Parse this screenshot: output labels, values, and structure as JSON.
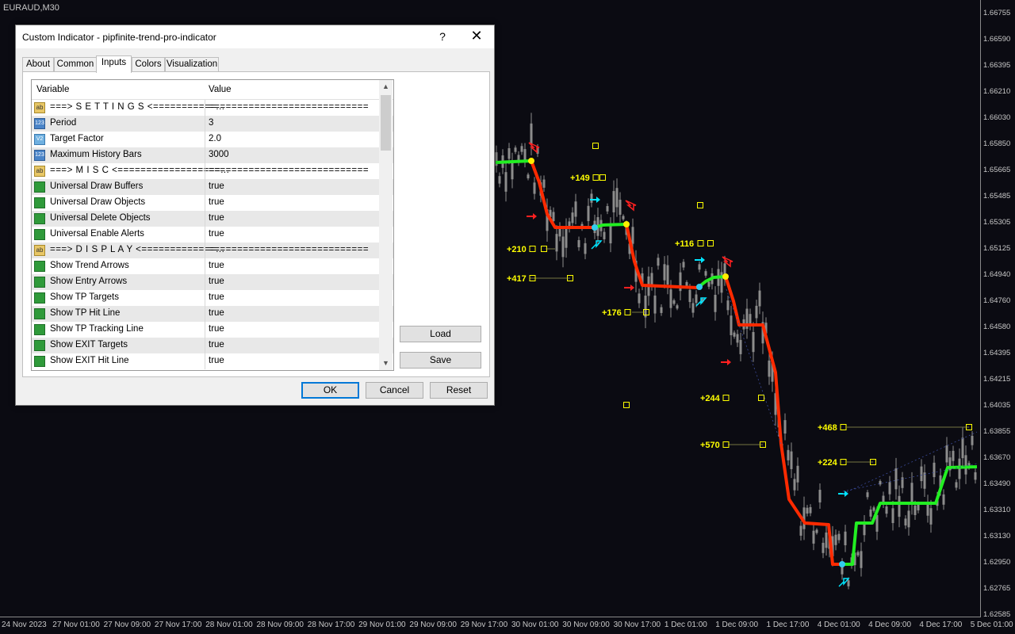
{
  "chart": {
    "symbol": "EURAUD,M30",
    "price_ticks": [
      "1.66755",
      "1.66590",
      "1.66395",
      "1.66210",
      "1.66030",
      "1.65850",
      "1.65665",
      "1.65485",
      "1.65305",
      "1.65125",
      "1.64940",
      "1.64760",
      "1.64580",
      "1.64395",
      "1.64215",
      "1.64035",
      "1.63855",
      "1.63670",
      "1.63490",
      "1.63310",
      "1.63130",
      "1.62950",
      "1.62765",
      "1.62585"
    ],
    "time_ticks": [
      "24 Nov 2023",
      "27 Nov 01:00",
      "27 Nov 09:00",
      "27 Nov 17:00",
      "28 Nov 01:00",
      "28 Nov 09:00",
      "28 Nov 17:00",
      "29 Nov 01:00",
      "29 Nov 09:00",
      "29 Nov 17:00",
      "30 Nov 01:00",
      "30 Nov 09:00",
      "30 Nov 17:00",
      "1 Dec 01:00",
      "1 Dec 09:00",
      "1 Dec 17:00",
      "4 Dec 01:00",
      "4 Dec 09:00",
      "4 Dec 17:00",
      "5 Dec 01:00"
    ],
    "tp_labels": [
      "+149",
      "+210",
      "+417",
      "+116",
      "+176",
      "+244",
      "+570",
      "+468",
      "+224"
    ],
    "colors": {
      "uptrend": "#22ee22",
      "downtrend": "#ff2a00",
      "up_arrow": "#00e5ff",
      "down_arrow": "#ff2020",
      "tp": "#ffff00",
      "candle": "#8c8c8c"
    }
  },
  "dialog": {
    "title": "Custom Indicator - pipfinite-trend-pro-indicator",
    "help": "?",
    "close": "✕",
    "tabs": [
      "About",
      "Common",
      "Inputs",
      "Colors",
      "Visualization"
    ],
    "active_tab": "Inputs",
    "columns": {
      "variable": "Variable",
      "value": "Value"
    },
    "rows": [
      {
        "icon": "ab",
        "name": "===> S E T T I N G S <===========...",
        "value": "============================"
      },
      {
        "icon": "123",
        "name": "Period",
        "value": "3"
      },
      {
        "icon": "v2",
        "name": "Target Factor",
        "value": "2.0"
      },
      {
        "icon": "123",
        "name": "Maximum History Bars",
        "value": "3000"
      },
      {
        "icon": "ab",
        "name": "===> M I S C <==================...",
        "value": "============================"
      },
      {
        "icon": "bool",
        "name": "Universal Draw Buffers",
        "value": "true"
      },
      {
        "icon": "bool",
        "name": "Universal Draw Objects",
        "value": "true"
      },
      {
        "icon": "bool",
        "name": "Universal Delete Objects",
        "value": "true"
      },
      {
        "icon": "bool",
        "name": "Universal Enable Alerts",
        "value": "true"
      },
      {
        "icon": "ab",
        "name": "===> D I S P L A Y <=============...",
        "value": "============================"
      },
      {
        "icon": "bool",
        "name": "Show Trend Arrows",
        "value": "true"
      },
      {
        "icon": "bool",
        "name": "Show Entry Arrows",
        "value": "true"
      },
      {
        "icon": "bool",
        "name": "Show TP Targets",
        "value": "true"
      },
      {
        "icon": "bool",
        "name": "Show TP Hit Line",
        "value": "true"
      },
      {
        "icon": "bool",
        "name": "Show TP Tracking Line",
        "value": "true"
      },
      {
        "icon": "bool",
        "name": "Show EXIT Targets",
        "value": "true"
      },
      {
        "icon": "bool",
        "name": "Show EXIT Hit Line",
        "value": "true"
      }
    ],
    "buttons": {
      "load": "Load",
      "save": "Save",
      "ok": "OK",
      "cancel": "Cancel",
      "reset": "Reset"
    }
  }
}
